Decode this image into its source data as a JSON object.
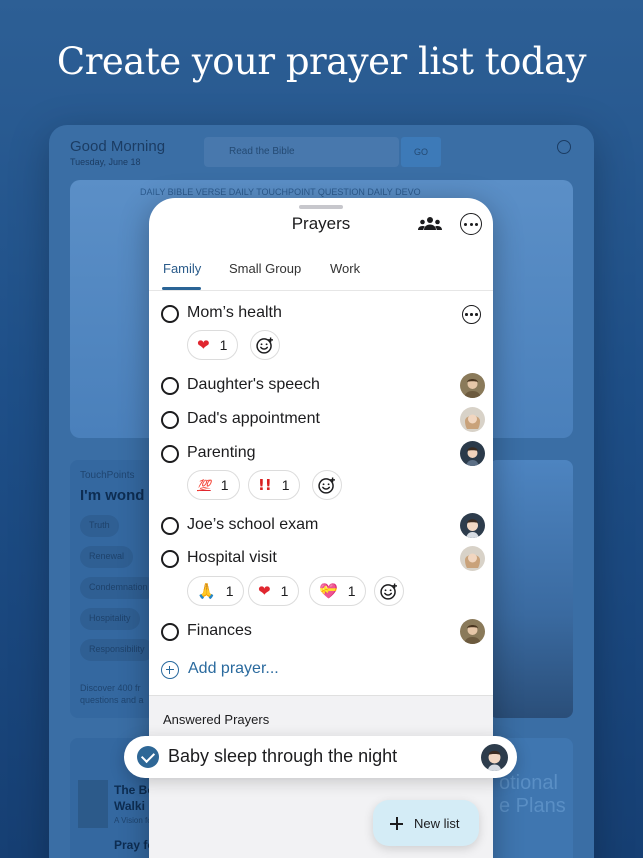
{
  "headline": "Create your prayer list today",
  "background_app": {
    "greeting": "Good Morning",
    "date": "Tuesday, June 18",
    "search_placeholder": "Read the Bible",
    "go_label": "GO",
    "hero_tabs": "DAILY BIBLE VERSE     DAILY TOUCHPOINT QUESTION     DAILY DEVO",
    "touchpoints_label": "TouchPoints",
    "touchpoints_title": "I'm wond",
    "chips": [
      "Truth",
      "Renewal",
      "Condemnation",
      "Hospitality",
      "Responsibility"
    ],
    "touchpoints_desc": "Discover 400 fr\nquestions and a",
    "book_title": "The Bo\nWalki",
    "book_sub": "A Vision fo",
    "book_title2": "Pray fo",
    "devotional": "otional\ne Plans"
  },
  "phone": {
    "title": "Prayers",
    "tabs": [
      {
        "label": "Family",
        "active": true
      },
      {
        "label": "Small Group",
        "active": false
      },
      {
        "label": "Work",
        "active": false
      }
    ],
    "prayers": [
      {
        "text": "Mom’s health",
        "reactions": [
          {
            "emoji": "❤",
            "count": "1",
            "color": "#e0262f"
          }
        ]
      },
      {
        "text": "Daughter's speech"
      },
      {
        "text": "Dad's appointment"
      },
      {
        "text": "Parenting",
        "reactions": [
          {
            "emoji": "💯",
            "count": "1",
            "color": "#e0262f"
          },
          {
            "emoji": "!!",
            "count": "1",
            "color": "#d92020"
          }
        ]
      },
      {
        "text": "Joe’s school exam"
      },
      {
        "text": "Hospital visit",
        "reactions": [
          {
            "emoji": "🙏",
            "count": "1",
            "color": "#e7a23b"
          },
          {
            "emoji": "❤",
            "count": "1",
            "color": "#e0262f"
          },
          {
            "emoji": "💝",
            "count": "1",
            "color": "#e85a9c"
          }
        ]
      },
      {
        "text": "Finances"
      }
    ],
    "add_prayer": "Add prayer...",
    "answered_title": "Answered Prayers"
  },
  "answered_card": {
    "text": "Baby sleep through the night"
  },
  "new_list_label": "New list",
  "colors": {
    "accent": "#2a6a9e",
    "background": "#1e4f88",
    "fab": "#d4ecf6"
  }
}
